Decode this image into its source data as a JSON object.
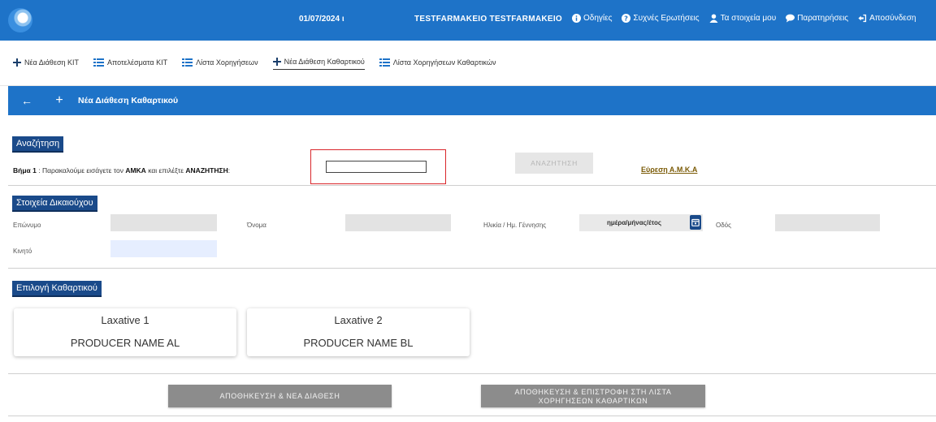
{
  "topbar": {
    "date": "01/07/2024 ι",
    "user": "TESTFARMAKEIO TESTFARMAKEIO",
    "links": [
      {
        "label": "Οδηγίες",
        "icon": "info-icon"
      },
      {
        "label": "Συχνές Ερωτήσεις",
        "icon": "question-icon"
      },
      {
        "label": "Τα στοιχεία μου",
        "icon": "user-icon"
      },
      {
        "label": "Παρατηρήσεις",
        "icon": "comment-icon"
      },
      {
        "label": "Αποσύνδεση",
        "icon": "logout-icon"
      }
    ],
    "color": "#1e73c8"
  },
  "subnav": {
    "items": [
      {
        "label": "Νέα Διάθεση ΚΙΤ",
        "icon": "plus-icon"
      },
      {
        "label": "Αποτελέσματα ΚΙΤ",
        "icon": "list-icon"
      },
      {
        "label": "Λίστα Χορηγήσεων",
        "icon": "list-icon"
      },
      {
        "label": "Νέα Διάθεση Καθαρτικού",
        "icon": "plus-icon",
        "active": true
      },
      {
        "label": "Λίστα Χορηγήσεων Καθαρτικών",
        "icon": "list-icon"
      }
    ]
  },
  "titlebar": {
    "back": "←",
    "plus": "+",
    "title": "Νέα Διάθεση Καθαρτικού"
  },
  "search": {
    "section_label": "Αναζήτηση",
    "step_prefix": "Βήμα 1",
    "step_text_1": " : Παρακαλούμε εισάγετε τον ",
    "step_amka": "ΑΜΚΑ",
    "step_text_2": " και επιλέξτε ",
    "step_search": "ΑΝΑΖΗΤΗΣΗ",
    "step_text_3": ":",
    "amka_value": "",
    "button_label": "ΑΝΑΖΗΤΗΣΗ",
    "find_link": "Εύρεση Α.Μ.Κ.Α"
  },
  "beneficiary": {
    "section_label": "Στοιχεία Δικαιούχου",
    "surname_label": "Επώνυμο",
    "name_label": "Όνομα",
    "age_label": "Ηλικία / Ημ. Γέννησης",
    "date_placeholder": "ημέρα/μήνας/έτος",
    "street_label": "Οδός",
    "mobile_label": "Κινητό"
  },
  "laxative": {
    "section_label": "Επιλογή Καθαρτικού",
    "cards": [
      {
        "name": "Laxative 1",
        "producer": "PRODUCER NAME AL"
      },
      {
        "name": "Laxative 2",
        "producer": "PRODUCER NAME BL"
      }
    ]
  },
  "actions": {
    "save_new": "ΑΠΟΘΗΚΕΥΣΗ & ΝΕΑ ΔΙΑΘΕΣΗ",
    "save_return_line1": "ΑΠΟΘΗΚΕΥΣΗ & ΕΠΙΣΤΡΟΦΗ ΣΤΗ ΛΙΣΤΑ",
    "save_return_line2": "ΧΟΡΗΓΗΣΕΩΝ ΚΑΘΑΡΤΙΚΩΝ"
  }
}
